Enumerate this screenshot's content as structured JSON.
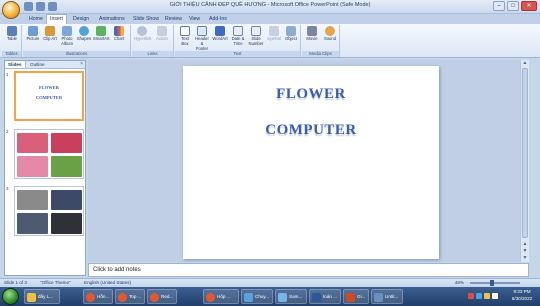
{
  "window": {
    "title": "GIỚI THIỆU CẢNH ĐẸP QUÊ HƯƠNG - Microsoft Office PowerPoint (Safe Mode)",
    "controls": {
      "minimize": "–",
      "maximize": "□",
      "close": "✕"
    }
  },
  "tabs": [
    "Home",
    "Insert",
    "Design",
    "Animations",
    "Slide Show",
    "Review",
    "View",
    "Add-Ins"
  ],
  "active_tab": "Insert",
  "ribbon": {
    "groups": [
      {
        "label": "Tables",
        "buttons": [
          "Table"
        ]
      },
      {
        "label": "Illustrations",
        "buttons": [
          "Picture",
          "Clip Art",
          "Photo Album",
          "Shapes",
          "SmartArt",
          "Chart"
        ]
      },
      {
        "label": "Links",
        "buttons": [
          "Hyperlink",
          "Action"
        ]
      },
      {
        "label": "Text",
        "buttons": [
          "Text Box",
          "Header & Footer",
          "WordArt",
          "Date & Time",
          "Slide Number",
          "Symbol",
          "Object"
        ]
      },
      {
        "label": "Media Clips",
        "buttons": [
          "Movie",
          "Sound"
        ]
      }
    ]
  },
  "left_pane": {
    "tabs": [
      "Slides",
      "Outline"
    ],
    "close": "×",
    "slides": [
      {
        "number": "1",
        "lines": [
          "FLOWER",
          "COMPUTER"
        ]
      },
      {
        "number": "2"
      },
      {
        "number": "3"
      }
    ]
  },
  "slide": {
    "line1": "FLOWER",
    "line2": "COMPUTER"
  },
  "notes": {
    "placeholder": "Click to add notes"
  },
  "status": {
    "slide": "Slide 1 of 3",
    "theme": "\"Office Theme\"",
    "language": "English (United States)",
    "zoom": "48%"
  },
  "taskbar": {
    "items": [
      "đây L...",
      "Hồn...",
      "Top ...",
      "Red...",
      "Hôp ...",
      "Chuy...",
      "Sam...",
      "toán ...",
      "Gi...",
      "Untit..."
    ],
    "time": "9:33 PM",
    "date": "6/30/2022"
  },
  "colors": {
    "accent": "#3b5ea6",
    "selection": "#f2a540"
  }
}
